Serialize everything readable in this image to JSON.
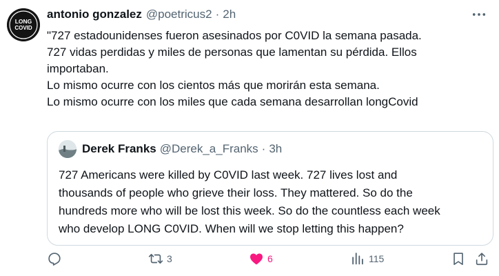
{
  "author": {
    "display_name": "antonio gonzalez",
    "handle": "@poetricus2",
    "separator": "·",
    "time": "2h",
    "avatar": {
      "line1": "LONG",
      "line2": "COVID",
      "background": "#141414",
      "ring": "#ffffff"
    }
  },
  "tweet": {
    "lines": [
      "\"727 estadounidenses fueron asesinados por C0VID la semana pasada.",
      "727 vidas perdidas y miles de personas que lamentan su pérdida. Ellos",
      "importaban.",
      "Lo mismo ocurre con los cientos más que morirán esta semana.",
      "Lo mismo ocurre con los miles que cada semana desarrollan longCovid"
    ]
  },
  "quote": {
    "display_name": "Derek Franks",
    "handle": "@Derek_a_Franks",
    "separator": "·",
    "time": "3h",
    "lines": [
      "727 Americans were killed by C0VID last week. 727 lives lost and",
      "thousands of people who grieve their loss. They mattered. So do the",
      "hundreds more who will be lost this week. So do the countless each week",
      "who develop LONG C0VID. When will we stop letting this happen?"
    ]
  },
  "actions": {
    "reply_count": "",
    "repost_count": "3",
    "like_count": "6",
    "views_count": "115",
    "like_color": "#f91880",
    "icon_color": "#536471"
  },
  "icons": [
    "more-icon",
    "reply-icon",
    "repost-icon",
    "like-icon",
    "views-icon",
    "bookmark-icon",
    "share-icon"
  ]
}
